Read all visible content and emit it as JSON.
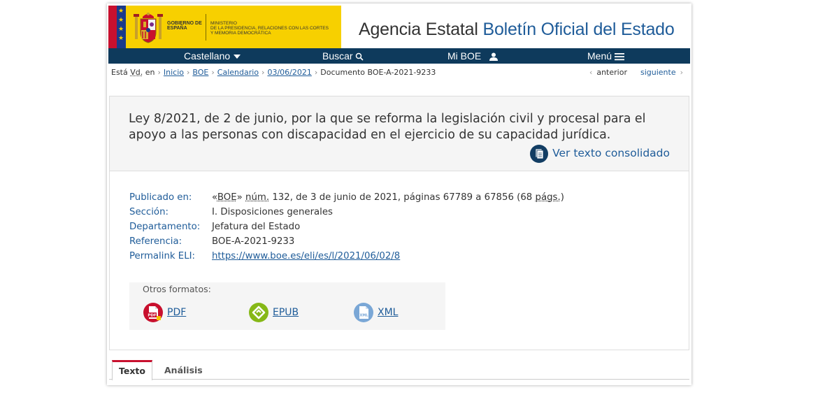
{
  "header": {
    "gov_label": "GOBIERNO DE ESPAÑA",
    "ministry_label": "MINISTERIO\nDE LA PRESIDENCIA, RELACIONES CON LAS CORTES\nY MEMORIA DEMOCRÁTICA",
    "site_title_prefix": "Agencia Estatal ",
    "site_title_highlight": "Boletín Oficial del Estado",
    "brand_yellow": "#f7d000",
    "brand_blue": "#1f5c99"
  },
  "nav": {
    "background": "#0e3a5c",
    "items": [
      {
        "label": "Castellano",
        "icon": "caret-down-icon"
      },
      {
        "label": "Buscar",
        "icon": "search-icon"
      },
      {
        "label": "Mi BOE",
        "icon": "user-icon"
      },
      {
        "label": "Menú",
        "icon": "hamburger-icon"
      }
    ]
  },
  "breadcrumb": {
    "prefix_a": "Está ",
    "prefix_abbr": "Vd.",
    "prefix_b": " en",
    "links": [
      "Inicio",
      "BOE",
      "Calendario",
      "03/06/2021"
    ],
    "current": "Documento BOE-A-2021-9233",
    "prev_label": "anterior",
    "next_label": "siguiente"
  },
  "document": {
    "title": "Ley 8/2021, de 2 de junio, por la que se reforma la legislación civil y procesal para el apoyo a las personas con discapacidad en el ejercicio de su capacidad jurídica.",
    "consolidated_label": "Ver texto consolidado"
  },
  "metadata": {
    "published": {
      "label": "Publicado en:",
      "v1": "«",
      "boe_abbr": "BOE",
      "v2": "» ",
      "num_abbr": "núm.",
      "v3": " 132, de 3 de junio de 2021, páginas 67789 a 67856 (68 ",
      "pags_abbr": "págs.",
      "v4": ")"
    },
    "section": {
      "label": "Sección:",
      "value": "I. Disposiciones generales"
    },
    "department": {
      "label": "Departamento:",
      "value": "Jefatura del Estado"
    },
    "reference": {
      "label": "Referencia:",
      "value": "BOE-A-2021-9233"
    },
    "permalink": {
      "label": "Permalink ELI:",
      "value": "https://www.boe.es/eli/es/l/2021/06/02/8"
    }
  },
  "formats": {
    "label": "Otros formatos:",
    "items": [
      {
        "label": "PDF",
        "icon": "pdf-icon"
      },
      {
        "label": "EPUB",
        "icon": "epub-icon"
      },
      {
        "label": "XML",
        "icon": "xml-icon"
      }
    ]
  },
  "tabs": [
    {
      "label": "Texto",
      "active": true
    },
    {
      "label": "Análisis",
      "active": false
    }
  ]
}
